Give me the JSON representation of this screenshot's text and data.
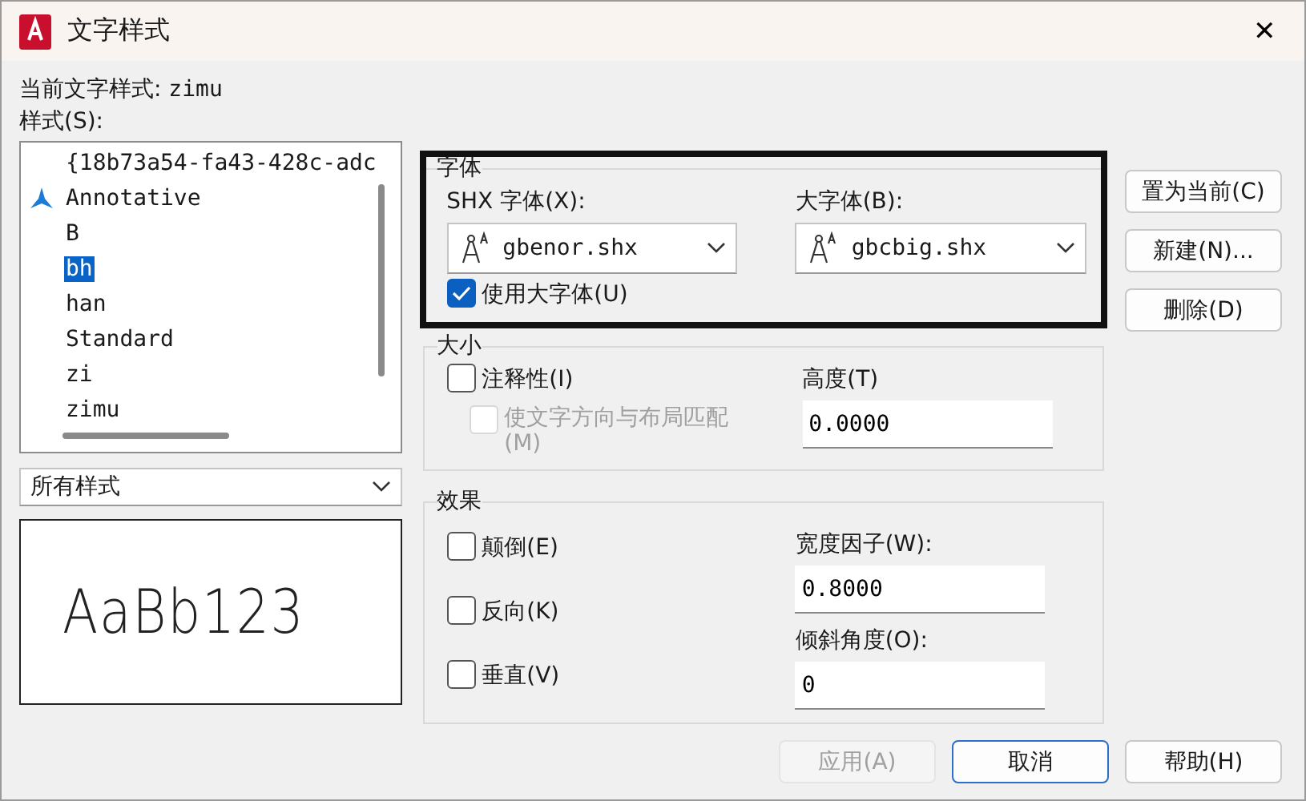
{
  "window": {
    "title": "文字样式",
    "close": "✕"
  },
  "current_style": {
    "label": "当前文字样式:",
    "value": "zimu"
  },
  "styles": {
    "label": "样式(S):",
    "items": [
      {
        "label": "{18b73a54-fa43-428c-adc",
        "annotative": false,
        "selected": false
      },
      {
        "label": "Annotative",
        "annotative": true,
        "selected": false
      },
      {
        "label": "B",
        "annotative": false,
        "selected": false
      },
      {
        "label": "bh",
        "annotative": false,
        "selected": true
      },
      {
        "label": "han",
        "annotative": false,
        "selected": false
      },
      {
        "label": "Standard",
        "annotative": false,
        "selected": false
      },
      {
        "label": "zi",
        "annotative": false,
        "selected": false
      },
      {
        "label": "zimu",
        "annotative": false,
        "selected": false
      }
    ]
  },
  "filter": {
    "value": "所有样式"
  },
  "preview": {
    "text": "AaBb123"
  },
  "font": {
    "title": "字体",
    "highlighted": true,
    "shx_font": {
      "label": "SHX 字体(X):",
      "value": "gbenor.shx"
    },
    "big_font": {
      "label": "大字体(B):",
      "value": "gbcbig.shx"
    },
    "use_big_font": {
      "label": "使用大字体(U)",
      "checked": true
    }
  },
  "size": {
    "title": "大小",
    "annotative": {
      "label": "注释性(I)",
      "checked": false
    },
    "match_orientation": {
      "label": "使文字方向与布局匹配(M)",
      "checked": false,
      "disabled": true
    },
    "height": {
      "label": "高度(T)",
      "value": "0.0000"
    }
  },
  "effects": {
    "title": "效果",
    "checks": [
      {
        "label": "颠倒(E)",
        "checked": false
      },
      {
        "label": "反向(K)",
        "checked": false
      },
      {
        "label": "垂直(V)",
        "checked": false
      }
    ],
    "width_factor": {
      "label": "宽度因子(W):",
      "value": "0.8000"
    },
    "oblique": {
      "label": "倾斜角度(O):",
      "value": "0"
    }
  },
  "side_buttons": [
    "置为当前(C)",
    "新建(N)...",
    "删除(D)"
  ],
  "bottom_buttons": [
    {
      "label": "应用(A)",
      "disabled": true,
      "kind": "plain"
    },
    {
      "label": "取消",
      "disabled": false,
      "kind": "default"
    },
    {
      "label": "帮助(H)",
      "disabled": false,
      "kind": "plain"
    }
  ]
}
